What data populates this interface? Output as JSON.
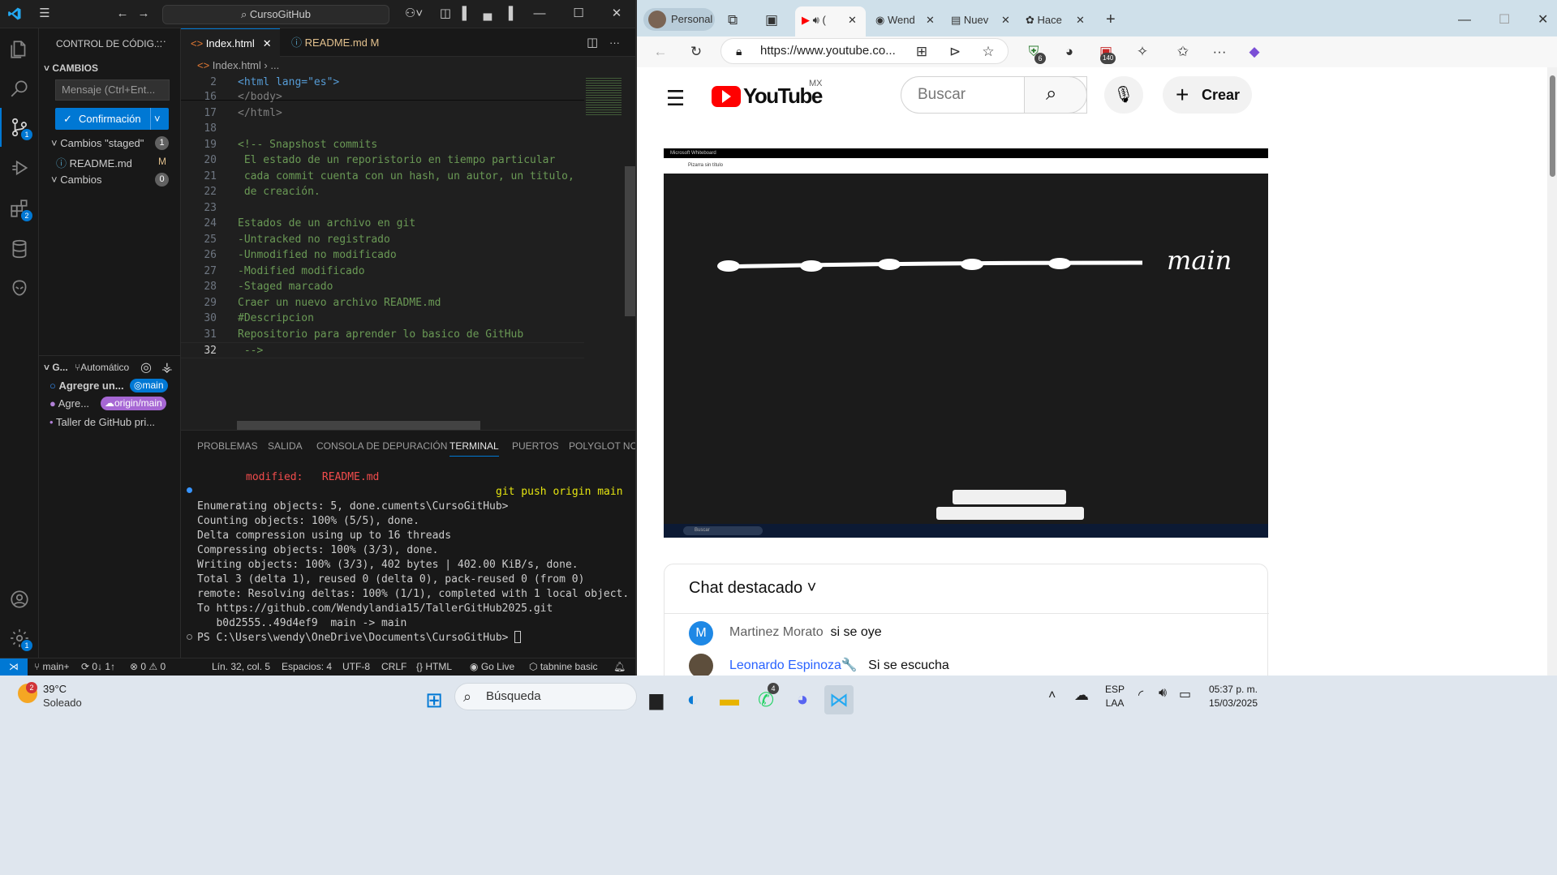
{
  "vscode": {
    "title_search": "CursoGitHub",
    "sidebar": {
      "header": "CONTROL DE CÓDIG...",
      "section": "CAMBIOS",
      "message_placeholder": "Mensaje (Ctrl+Ent...",
      "commit_label": "Confirmación",
      "staged_label": "Cambios \"staged\"",
      "staged_count": "1",
      "staged_file": "README.md",
      "staged_status": "M",
      "changes_label": "Cambios",
      "changes_count": "0",
      "graph_header": "G...",
      "graph_auto": "Automático",
      "graph_items": [
        {
          "label": "Agregre un...",
          "tag": "main"
        },
        {
          "label": "Agre...",
          "tag": "origin/main"
        },
        {
          "label": "Taller de GitHub pri...",
          "tag": ""
        }
      ]
    },
    "activity_badges": {
      "scm": "1",
      "extensions": "2",
      "settings": "1"
    },
    "tabs": [
      {
        "label": "Index.html",
        "icon": "<>",
        "active": true
      },
      {
        "label": "README.md",
        "status": "M",
        "active": false
      }
    ],
    "breadcrumb": [
      "Index.html",
      "..."
    ],
    "code_lines": [
      {
        "n": "2",
        "text": "<html lang=\"es\">"
      },
      {
        "n": "16",
        "text": "</body>"
      },
      {
        "n": "17",
        "text": "</html>"
      },
      {
        "n": "18",
        "text": ""
      },
      {
        "n": "19",
        "text": "<!-- Snapshost commits"
      },
      {
        "n": "20",
        "text": " El estado de un reporistorio en tiempo particular"
      },
      {
        "n": "21",
        "text": " cada commit cuenta con un hash, un autor, un titulo,"
      },
      {
        "n": "22",
        "text": " de creación."
      },
      {
        "n": "23",
        "text": ""
      },
      {
        "n": "24",
        "text": "Estados de un archivo en git"
      },
      {
        "n": "25",
        "text": "-Untracked no registrado"
      },
      {
        "n": "26",
        "text": "-Unmodified no modificado"
      },
      {
        "n": "27",
        "text": "-Modified modificado"
      },
      {
        "n": "28",
        "text": "-Staged marcado"
      },
      {
        "n": "29",
        "text": "Craer un nuevo archivo README.md"
      },
      {
        "n": "30",
        "text": "#Descripcion"
      },
      {
        "n": "31",
        "text": "Repositorio para aprender lo basico de GitHub"
      },
      {
        "n": "32",
        "text": " -->"
      }
    ],
    "panel_tabs": [
      "PROBLEMAS",
      "SALIDA",
      "CONSOLA DE DEPURACIÓN",
      "TERMINAL",
      "PUERTOS",
      "POLYGLOT NOTE"
    ],
    "terminal": {
      "modified_line": "modified:   README.md",
      "command": "git push origin main",
      "lines": [
        "Enumerating objects: 5, done.cuments\\CursoGitHub>",
        "Counting objects: 100% (5/5), done.",
        "Delta compression using up to 16 threads",
        "Compressing objects: 100% (3/3), done.",
        "Writing objects: 100% (3/3), 402 bytes | 402.00 KiB/s, done.",
        "Total 3 (delta 1), reused 0 (delta 0), pack-reused 0 (from 0)",
        "remote: Resolving deltas: 100% (1/1), completed with 1 local object.",
        "To https://github.com/Wendylandia15/TallerGitHub2025.git",
        "   b0d2555..49d4ef9  main -> main"
      ],
      "prompt": "PS C:\\Users\\wendy\\OneDrive\\Documents\\CursoGitHub> "
    },
    "status": {
      "branch": "main+",
      "sync": "0↓ 1↑",
      "errors": "0",
      "warnings": "0",
      "position": "Lín. 32, col. 5",
      "spaces": "Espacios: 4",
      "encoding": "UTF-8",
      "eol": "CRLF",
      "language": "HTML",
      "golive": "Go Live",
      "tabnine": "tabnine basic"
    }
  },
  "browser": {
    "profile": "Personal",
    "tabs": [
      "(",
      "Wend",
      "Nuev",
      "Hace"
    ],
    "url": "https://www.youtube.co...",
    "badges": {
      "ext1": "6",
      "ext2": "140"
    },
    "youtube": {
      "logo": "YouTube",
      "region": "MX",
      "search_placeholder": "Buscar",
      "create": "Crear",
      "video": {
        "app_title": "Microsoft Whiteboard",
        "board_name": "Pizarra sin título",
        "handwriting": "main",
        "search": "Buscar"
      },
      "chat_header": "Chat destacado",
      "messages": [
        {
          "avatar": "M",
          "author": "Martinez Morato",
          "text": "si se oye",
          "color": "#1e88e5"
        },
        {
          "avatar": "",
          "author": "Leonardo Espinoza🔧",
          "text": "Si se escucha",
          "color": "#2962ff"
        }
      ]
    }
  },
  "taskbar": {
    "weather_temp": "39°C",
    "weather_desc": "Soleado",
    "weather_badge": "2",
    "search": "Búsqueda",
    "whatsapp_badge": "4",
    "lang": "ESP",
    "layout": "LAA",
    "time": "05:37 p. m.",
    "date": "15/03/2025"
  }
}
